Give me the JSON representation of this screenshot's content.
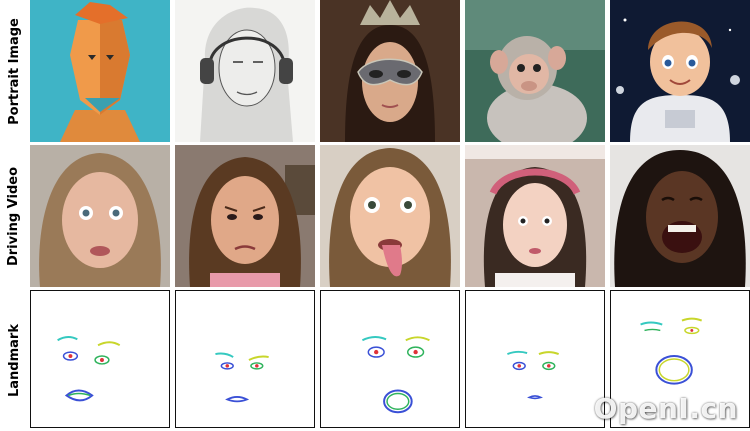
{
  "rows": {
    "portrait_label": "Portrait Image",
    "driving_label": "Driving Video",
    "landmark_label": "Landmark"
  },
  "watermark": "OpenI.cn",
  "colors": {
    "landmark_border": "#111111",
    "eye_brow_1": "#35c9c0",
    "eye_brow_2": "#c8d62b",
    "mouth_blue": "#3a50d6",
    "mouth_green": "#2fb35c",
    "iris_red": "#e0323a"
  }
}
